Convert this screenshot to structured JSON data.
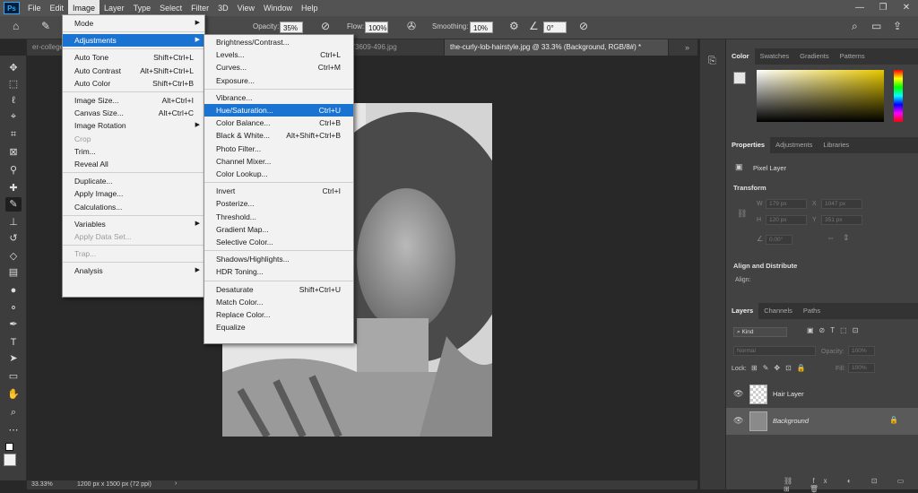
{
  "app": {
    "logo": "Ps"
  },
  "menubar": [
    "File",
    "Edit",
    "Image",
    "Layer",
    "Type",
    "Select",
    "Filter",
    "3D",
    "View",
    "Window",
    "Help"
  ],
  "options": {
    "opacity_label": "Opacity:",
    "opacity": "35%",
    "flow_label": "Flow:",
    "flow": "100%",
    "smoothing_label": "Smoothing:",
    "smoothing": "10%",
    "angle": "0°"
  },
  "tabs": [
    "er-college",
    "ing_273609-496.jpg",
    "the-curly-lob-hairstyle.jpg @ 33.3% (Background, RGB/8#) *"
  ],
  "status": {
    "zoom": "33.33%",
    "dims": "1200 px x 1500 px (72 ppi)"
  },
  "image_menu": [
    {
      "label": "Mode",
      "arrow": true
    },
    {
      "sep": true
    },
    {
      "label": "Adjustments",
      "arrow": true,
      "hl": true
    },
    {
      "sep": true
    },
    {
      "label": "Auto Tone",
      "sc": "Shift+Ctrl+L"
    },
    {
      "label": "Auto Contrast",
      "sc": "Alt+Shift+Ctrl+L"
    },
    {
      "label": "Auto Color",
      "sc": "Shift+Ctrl+B"
    },
    {
      "sep": true
    },
    {
      "label": "Image Size...",
      "sc": "Alt+Ctrl+I"
    },
    {
      "label": "Canvas Size...",
      "sc": "Alt+Ctrl+C"
    },
    {
      "label": "Image Rotation",
      "arrow": true
    },
    {
      "label": "Crop",
      "dis": true
    },
    {
      "label": "Trim..."
    },
    {
      "label": "Reveal All"
    },
    {
      "sep": true
    },
    {
      "label": "Duplicate..."
    },
    {
      "label": "Apply Image..."
    },
    {
      "label": "Calculations..."
    },
    {
      "sep": true
    },
    {
      "label": "Variables",
      "arrow": true
    },
    {
      "label": "Apply Data Set...",
      "dis": true
    },
    {
      "sep": true
    },
    {
      "label": "Trap...",
      "dis": true
    },
    {
      "sep": true
    },
    {
      "label": "Analysis",
      "arrow": true
    }
  ],
  "adjust_menu": [
    {
      "label": "Brightness/Contrast..."
    },
    {
      "label": "Levels...",
      "sc": "Ctrl+L"
    },
    {
      "label": "Curves...",
      "sc": "Ctrl+M"
    },
    {
      "label": "Exposure..."
    },
    {
      "sep": true
    },
    {
      "label": "Vibrance..."
    },
    {
      "label": "Hue/Saturation...",
      "sc": "Ctrl+U",
      "hl": true
    },
    {
      "label": "Color Balance...",
      "sc": "Ctrl+B"
    },
    {
      "label": "Black & White...",
      "sc": "Alt+Shift+Ctrl+B"
    },
    {
      "label": "Photo Filter..."
    },
    {
      "label": "Channel Mixer..."
    },
    {
      "label": "Color Lookup..."
    },
    {
      "sep": true
    },
    {
      "label": "Invert",
      "sc": "Ctrl+I"
    },
    {
      "label": "Posterize..."
    },
    {
      "label": "Threshold..."
    },
    {
      "label": "Gradient Map..."
    },
    {
      "label": "Selective Color..."
    },
    {
      "sep": true
    },
    {
      "label": "Shadows/Highlights..."
    },
    {
      "label": "HDR Toning..."
    },
    {
      "sep": true
    },
    {
      "label": "Desaturate",
      "sc": "Shift+Ctrl+U"
    },
    {
      "label": "Match Color..."
    },
    {
      "label": "Replace Color..."
    },
    {
      "label": "Equalize"
    }
  ],
  "color_panel": {
    "tabs": [
      "Color",
      "Swatches",
      "Gradients",
      "Patterns"
    ]
  },
  "properties": {
    "tabs": [
      "Properties",
      "Adjustments",
      "Libraries"
    ],
    "kind": "Pixel Layer",
    "transform": "Transform",
    "w_label": "W",
    "w": "179 px",
    "x_label": "X",
    "x": "1047 px",
    "h_label": "H",
    "h": "120 px",
    "y_label": "Y",
    "y": "351 px",
    "angle": "0.00°",
    "align": "Align and Distribute",
    "align_sub": "Align:"
  },
  "layers": {
    "tabs": [
      "Layers",
      "Channels",
      "Paths"
    ],
    "filter": "Kind",
    "blend": "Normal",
    "opacity_label": "Opacity:",
    "opacity": "100%",
    "lock_label": "Lock:",
    "fill_label": "Fill:",
    "fill": "100%",
    "items": [
      {
        "name": "Hair Layer"
      },
      {
        "name": "Background"
      }
    ]
  }
}
